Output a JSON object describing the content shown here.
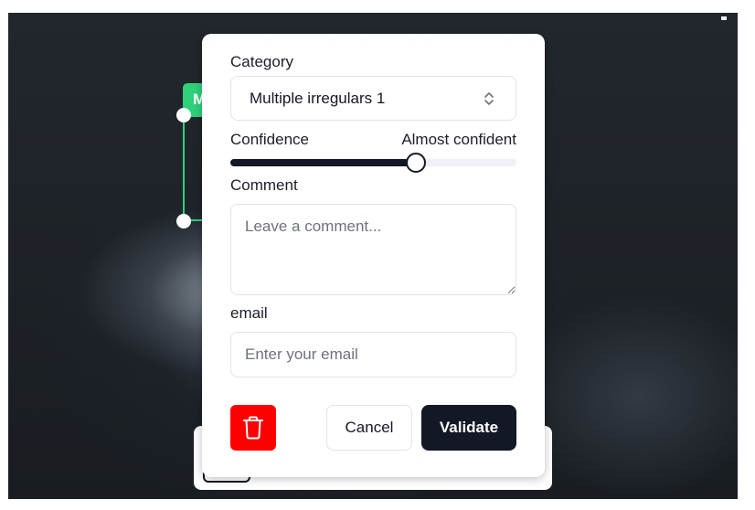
{
  "annotation": {
    "tag_text": "M",
    "color": "#2fd07a"
  },
  "form": {
    "category_label": "Category",
    "category_value": "Multiple irregulars 1",
    "confidence_label": "Confidence",
    "confidence_value": "Almost confident",
    "confidence_level": 0.65,
    "comment_label": "Comment",
    "comment_placeholder": "Leave a comment...",
    "email_label": "email",
    "email_placeholder": "Enter your email"
  },
  "actions": {
    "cancel_label": "Cancel",
    "validate_label": "Validate",
    "delete_icon": "trash-icon",
    "delete_color": "#ff0000",
    "primary_color": "#121826"
  }
}
